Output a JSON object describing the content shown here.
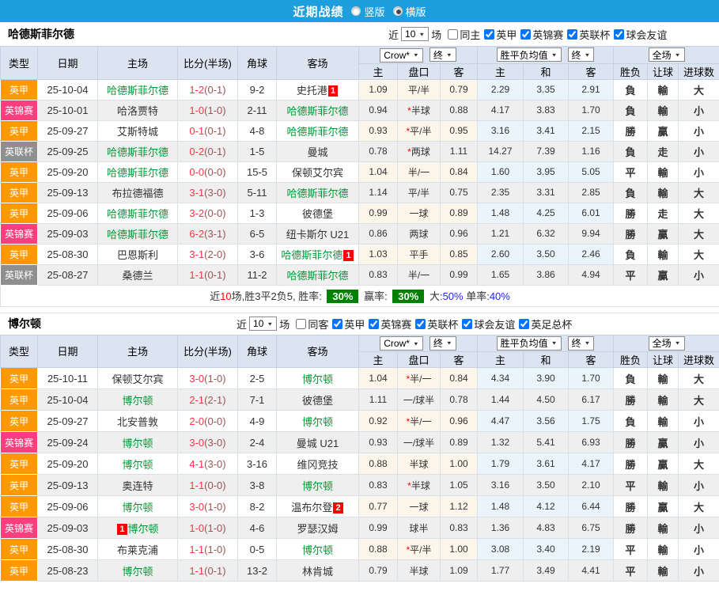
{
  "topbar": {
    "title": "近期战绩",
    "vertical_label": "竖版",
    "horizontal_label": "横版",
    "selected": "横版"
  },
  "columns": {
    "type": "类型",
    "date": "日期",
    "home": "主场",
    "score": "比分(半场)",
    "corner": "角球",
    "away": "客场",
    "dd_bookmaker": "Crow*",
    "dd_final_a": "终",
    "dd_mean": "胜平负均值",
    "dd_final_b": "终",
    "dd_scope": "全场",
    "sub": [
      "主",
      "盘口",
      "客",
      "主",
      "和",
      "客",
      "胜负",
      "让球",
      "进球数"
    ]
  },
  "sections": [
    {
      "team": "哈德斯菲尔德",
      "filter": {
        "near_label": "近",
        "count": "10",
        "matches_label": "场",
        "same_label": "同主",
        "same_checked": false,
        "leagues": [
          {
            "label": "英甲",
            "checked": true
          },
          {
            "label": "英锦赛",
            "checked": true
          },
          {
            "label": "英联杯",
            "checked": true
          },
          {
            "label": "球会友谊",
            "checked": true
          }
        ]
      },
      "rows": [
        {
          "league": "英甲",
          "date": "25-10-04",
          "home": "哈德斯菲尔德",
          "home_focus": true,
          "away": "史托港",
          "away_badge": "1",
          "score": "1-2",
          "half": "(0-1)",
          "corner": "9-2",
          "odds": [
            "1.09",
            "平/半",
            "0.79"
          ],
          "mean": [
            "2.29",
            "3.35",
            "2.91"
          ],
          "res": [
            "負",
            "輸",
            "大"
          ]
        },
        {
          "league": "英锦赛",
          "date": "25-10-01",
          "home": "哈洛贾特",
          "away": "哈德斯菲尔德",
          "away_focus": true,
          "score": "1-0",
          "half": "(1-0)",
          "corner": "2-11",
          "odds": [
            "0.94",
            "*半球",
            "0.88"
          ],
          "mean": [
            "4.17",
            "3.83",
            "1.70"
          ],
          "res": [
            "負",
            "輸",
            "小"
          ]
        },
        {
          "league": "英甲",
          "date": "25-09-27",
          "home": "艾斯特城",
          "away": "哈德斯菲尔德",
          "away_focus": true,
          "score": "0-1",
          "half": "(0-1)",
          "corner": "4-8",
          "odds": [
            "0.93",
            "*平/半",
            "0.95"
          ],
          "mean": [
            "3.16",
            "3.41",
            "2.15"
          ],
          "res": [
            "勝",
            "贏",
            "小"
          ]
        },
        {
          "league": "英联杯",
          "date": "25-09-25",
          "home": "哈德斯菲尔德",
          "home_focus": true,
          "away": "曼城",
          "score": "0-2",
          "half": "(0-1)",
          "corner": "1-5",
          "odds": [
            "0.78",
            "*两球",
            "1.11"
          ],
          "mean": [
            "14.27",
            "7.39",
            "1.16"
          ],
          "res": [
            "負",
            "走",
            "小"
          ]
        },
        {
          "league": "英甲",
          "date": "25-09-20",
          "home": "哈德斯菲尔德",
          "home_focus": true,
          "away": "保顿艾尔宾",
          "score": "0-0",
          "half": "(0-0)",
          "corner": "15-5",
          "odds": [
            "1.04",
            "半/一",
            "0.84"
          ],
          "mean": [
            "1.60",
            "3.95",
            "5.05"
          ],
          "res": [
            "平",
            "輸",
            "小"
          ]
        },
        {
          "league": "英甲",
          "date": "25-09-13",
          "home": "布拉德福德",
          "away": "哈德斯菲尔德",
          "away_focus": true,
          "score": "3-1",
          "half": "(3-0)",
          "corner": "5-11",
          "odds": [
            "1.14",
            "平/半",
            "0.75"
          ],
          "mean": [
            "2.35",
            "3.31",
            "2.85"
          ],
          "res": [
            "負",
            "輸",
            "大"
          ]
        },
        {
          "league": "英甲",
          "date": "25-09-06",
          "home": "哈德斯菲尔德",
          "home_focus": true,
          "away": "彼德堡",
          "score": "3-2",
          "half": "(0-0)",
          "corner": "1-3",
          "odds": [
            "0.99",
            "一球",
            "0.89"
          ],
          "mean": [
            "1.48",
            "4.25",
            "6.01"
          ],
          "res": [
            "勝",
            "走",
            "大"
          ]
        },
        {
          "league": "英锦赛",
          "date": "25-09-03",
          "home": "哈德斯菲尔德",
          "home_focus": true,
          "away": "纽卡斯尔 U21",
          "score": "6-2",
          "half": "(3-1)",
          "corner": "6-5",
          "odds": [
            "0.86",
            "两球",
            "0.96"
          ],
          "mean": [
            "1.21",
            "6.32",
            "9.94"
          ],
          "res": [
            "勝",
            "贏",
            "大"
          ]
        },
        {
          "league": "英甲",
          "date": "25-08-30",
          "home": "巴恩斯利",
          "away": "哈德斯菲尔德",
          "away_focus": true,
          "away_badge": "1",
          "score": "3-1",
          "half": "(2-0)",
          "corner": "3-6",
          "odds": [
            "1.03",
            "平手",
            "0.85"
          ],
          "mean": [
            "2.60",
            "3.50",
            "2.46"
          ],
          "res": [
            "負",
            "輸",
            "大"
          ]
        },
        {
          "league": "英联杯",
          "date": "25-08-27",
          "home": "桑德兰",
          "away": "哈德斯菲尔德",
          "away_focus": true,
          "score": "1-1",
          "half": "(0-1)",
          "corner": "11-2",
          "odds": [
            "0.83",
            "半/一",
            "0.99"
          ],
          "mean": [
            "1.65",
            "3.86",
            "4.94"
          ],
          "res": [
            "平",
            "贏",
            "小"
          ]
        }
      ],
      "summary": {
        "parts": [
          {
            "t": "近",
            "c": "plain"
          },
          {
            "t": "10",
            "c": "red"
          },
          {
            "t": "场,胜3平2负5, 胜率: ",
            "c": "plain"
          },
          {
            "t": "30%",
            "c": "badge"
          },
          {
            "t": " 赢率: ",
            "c": "plain"
          },
          {
            "t": "30%",
            "c": "badge"
          },
          {
            "t": " 大:",
            "c": "plain"
          },
          {
            "t": "50%",
            "c": "blue"
          },
          {
            "t": " 单率:",
            "c": "plain"
          },
          {
            "t": "40%",
            "c": "blue"
          }
        ]
      }
    },
    {
      "team": "博尔顿",
      "filter": {
        "near_label": "近",
        "count": "10",
        "matches_label": "场",
        "same_label": "同客",
        "same_checked": false,
        "leagues": [
          {
            "label": "英甲",
            "checked": true
          },
          {
            "label": "英锦赛",
            "checked": true
          },
          {
            "label": "英联杯",
            "checked": true
          },
          {
            "label": "球会友谊",
            "checked": true
          },
          {
            "label": "英足总杯",
            "checked": true
          }
        ]
      },
      "rows": [
        {
          "league": "英甲",
          "date": "25-10-11",
          "home": "保顿艾尔宾",
          "away": "博尔顿",
          "away_focus": true,
          "score": "3-0",
          "half": "(1-0)",
          "corner": "2-5",
          "odds": [
            "1.04",
            "*半/一",
            "0.84"
          ],
          "mean": [
            "4.34",
            "3.90",
            "1.70"
          ],
          "res": [
            "負",
            "輸",
            "大"
          ]
        },
        {
          "league": "英甲",
          "date": "25-10-04",
          "home": "博尔顿",
          "home_focus": true,
          "away": "彼德堡",
          "score": "2-1",
          "half": "(2-1)",
          "corner": "7-1",
          "odds": [
            "1.11",
            "一/球半",
            "0.78"
          ],
          "mean": [
            "1.44",
            "4.50",
            "6.17"
          ],
          "res": [
            "勝",
            "輸",
            "大"
          ]
        },
        {
          "league": "英甲",
          "date": "25-09-27",
          "home": "北安普敦",
          "away": "博尔顿",
          "away_focus": true,
          "score": "2-0",
          "half": "(0-0)",
          "corner": "4-9",
          "odds": [
            "0.92",
            "*半/一",
            "0.96"
          ],
          "mean": [
            "4.47",
            "3.56",
            "1.75"
          ],
          "res": [
            "負",
            "輸",
            "小"
          ]
        },
        {
          "league": "英锦赛",
          "date": "25-09-24",
          "home": "博尔顿",
          "home_focus": true,
          "away": "曼城 U21",
          "score": "3-0",
          "half": "(3-0)",
          "corner": "2-4",
          "odds": [
            "0.93",
            "一/球半",
            "0.89"
          ],
          "mean": [
            "1.32",
            "5.41",
            "6.93"
          ],
          "res": [
            "勝",
            "贏",
            "小"
          ]
        },
        {
          "league": "英甲",
          "date": "25-09-20",
          "home": "博尔顿",
          "home_focus": true,
          "away": "维冈竞技",
          "score": "4-1",
          "half": "(3-0)",
          "corner": "3-16",
          "odds": [
            "0.88",
            "半球",
            "1.00"
          ],
          "mean": [
            "1.79",
            "3.61",
            "4.17"
          ],
          "res": [
            "勝",
            "贏",
            "大"
          ]
        },
        {
          "league": "英甲",
          "date": "25-09-13",
          "home": "奥连特",
          "away": "博尔顿",
          "away_focus": true,
          "score": "1-1",
          "half": "(0-0)",
          "corner": "3-8",
          "odds": [
            "0.83",
            "*半球",
            "1.05"
          ],
          "mean": [
            "3.16",
            "3.50",
            "2.10"
          ],
          "res": [
            "平",
            "輸",
            "小"
          ]
        },
        {
          "league": "英甲",
          "date": "25-09-06",
          "home": "博尔顿",
          "home_focus": true,
          "away": "温布尔登",
          "away_badge": "2",
          "score": "3-0",
          "half": "(1-0)",
          "corner": "8-2",
          "odds": [
            "0.77",
            "一球",
            "1.12"
          ],
          "mean": [
            "1.48",
            "4.12",
            "6.44"
          ],
          "res": [
            "勝",
            "贏",
            "大"
          ]
        },
        {
          "league": "英锦赛",
          "date": "25-09-03",
          "home": "博尔顿",
          "home_focus": true,
          "home_badge": "1",
          "home_badge_before": true,
          "away": "罗瑟汉姆",
          "score": "1-0",
          "half": "(1-0)",
          "corner": "4-6",
          "odds": [
            "0.99",
            "球半",
            "0.83"
          ],
          "mean": [
            "1.36",
            "4.83",
            "6.75"
          ],
          "res": [
            "勝",
            "輸",
            "小"
          ]
        },
        {
          "league": "英甲",
          "date": "25-08-30",
          "home": "布莱克浦",
          "away": "博尔顿",
          "away_focus": true,
          "score": "1-1",
          "half": "(1-0)",
          "corner": "0-5",
          "odds": [
            "0.88",
            "*平/半",
            "1.00"
          ],
          "mean": [
            "3.08",
            "3.40",
            "2.19"
          ],
          "res": [
            "平",
            "輸",
            "小"
          ]
        },
        {
          "league": "英甲",
          "date": "25-08-23",
          "home": "博尔顿",
          "home_focus": true,
          "away": "林肯城",
          "score": "1-1",
          "half": "(0-1)",
          "corner": "13-2",
          "odds": [
            "0.79",
            "半球",
            "1.09"
          ],
          "mean": [
            "1.77",
            "3.49",
            "4.41"
          ],
          "res": [
            "平",
            "輸",
            "小"
          ]
        }
      ]
    }
  ]
}
